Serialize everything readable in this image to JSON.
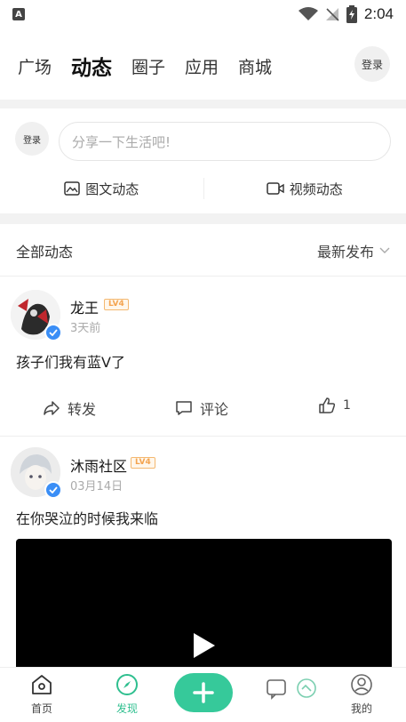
{
  "status_bar": {
    "time": "2:04",
    "notification_glyph": "A"
  },
  "top_nav": {
    "tabs": [
      {
        "label": "广场",
        "active": false
      },
      {
        "label": "动态",
        "active": true
      },
      {
        "label": "圈子",
        "active": false
      },
      {
        "label": "应用",
        "active": false
      },
      {
        "label": "商城",
        "active": false
      }
    ],
    "login_label": "登录"
  },
  "compose": {
    "avatar_label": "登录",
    "placeholder": "分享一下生活吧!",
    "image_post_label": "图文动态",
    "video_post_label": "视频动态"
  },
  "feed": {
    "title": "全部动态",
    "sort_label": "最新发布"
  },
  "posts": [
    {
      "username": "龙王",
      "level": "LV4",
      "time": "3天前",
      "text": "孩子们我有蓝V了",
      "repost_label": "转发",
      "comment_label": "评论",
      "like_count": "1"
    },
    {
      "username": "沐雨社区",
      "level": "LV4",
      "time": "03月14日",
      "text": "在你哭泣的时候我来临"
    }
  ],
  "bottom_nav": {
    "items": [
      {
        "label": "首页",
        "icon": "home-icon",
        "active": false
      },
      {
        "label": "发现",
        "icon": "compass-icon",
        "active": true
      },
      {
        "label": "我的",
        "icon": "profile-icon",
        "active": false
      }
    ]
  },
  "colors": {
    "accent": "#36c99a",
    "verified": "#3a8ef6",
    "level_badge": "#f4a450"
  }
}
